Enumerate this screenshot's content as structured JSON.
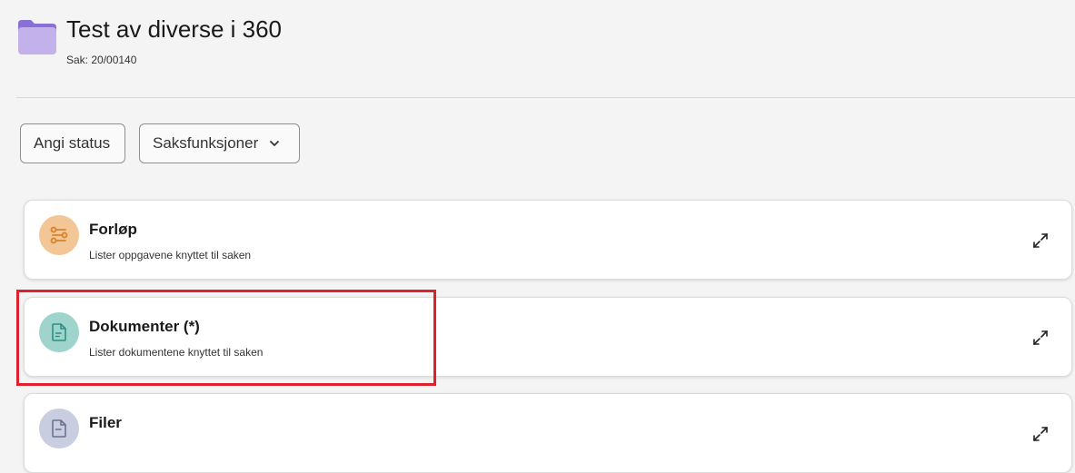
{
  "header": {
    "title": "Test av diverse i 360",
    "case_label": "Sak: 20/00140",
    "icon": "folder-icon",
    "icon_color": "#b9a6e8"
  },
  "toolbar": {
    "status_label": "Angi status",
    "functions_label": "Saksfunksjoner",
    "functions_icon": "chevron-down-icon"
  },
  "cards": [
    {
      "title": "Forløp",
      "description": "Lister oppgavene knyttet til saken",
      "icon": "workflow-icon",
      "icon_bg": "#f2c697",
      "action_icon": "expand-icon"
    },
    {
      "title": "Dokumenter (*)",
      "description": "Lister dokumentene knyttet til saken",
      "icon": "document-icon",
      "icon_bg": "#9fd4cd",
      "action_icon": "expand-icon"
    },
    {
      "title": "Filer",
      "description": "",
      "icon": "file-icon",
      "icon_bg": "#c9cde0",
      "action_icon": "expand-icon"
    }
  ],
  "highlight_color": "#e0202c"
}
